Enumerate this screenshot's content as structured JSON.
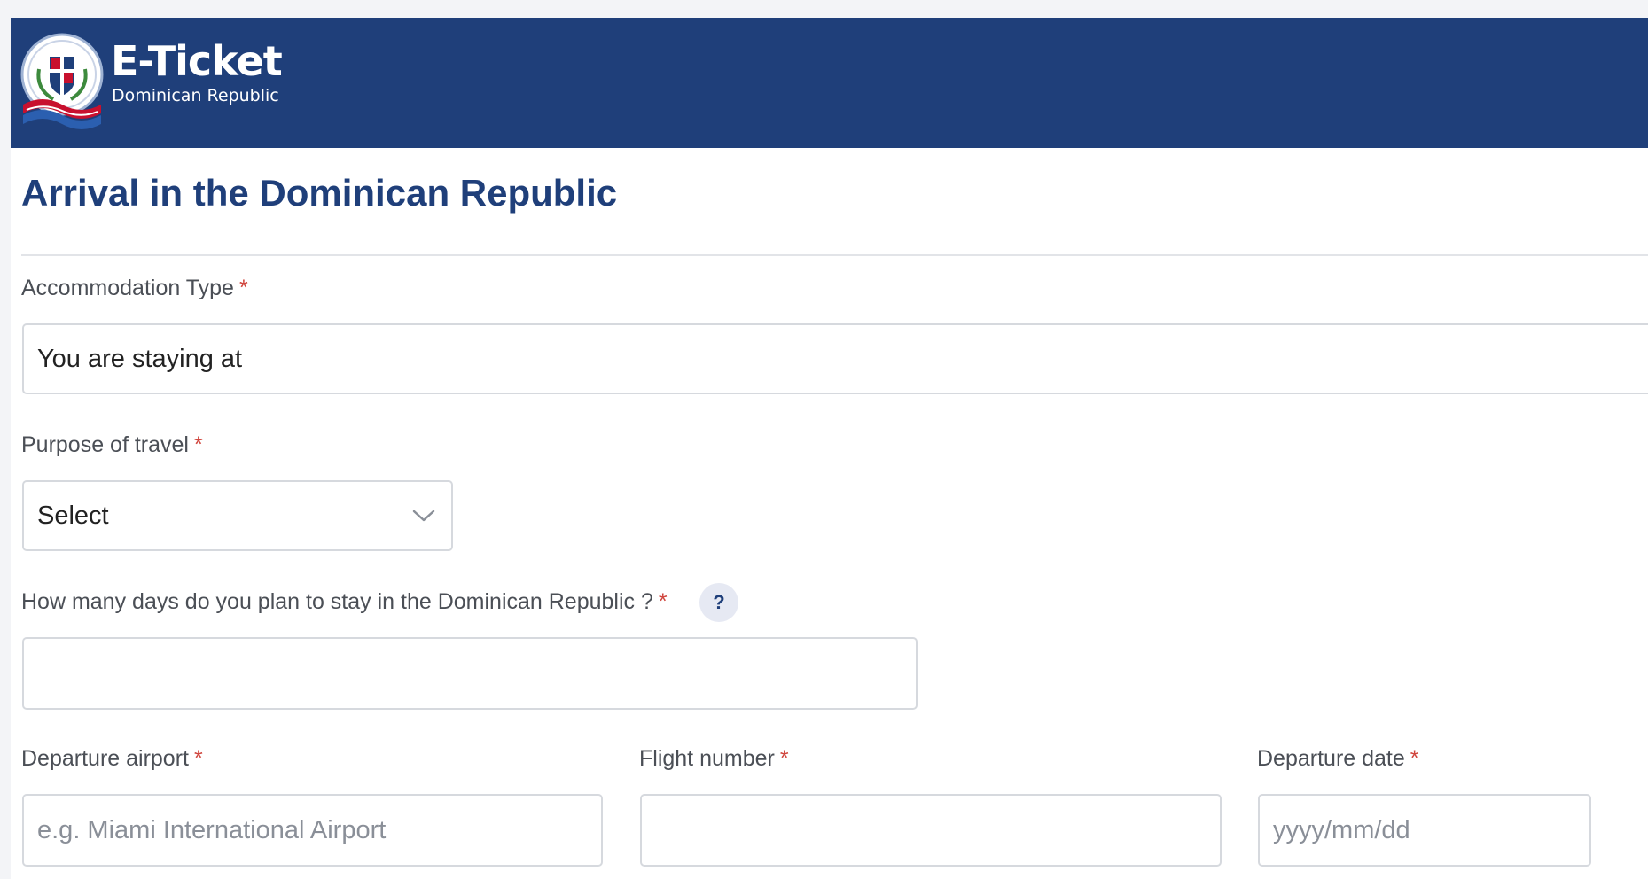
{
  "header": {
    "title": "E-Ticket",
    "subtitle": "Dominican Republic",
    "logo_icon": "dominican-coat-of-arms-logo",
    "background_color": "#1f3f7a"
  },
  "page": {
    "title": "Arrival in the Dominican Republic",
    "required_marker": "*"
  },
  "form": {
    "accommodation_type": {
      "label": "Accommodation Type",
      "value": "You are staying at"
    },
    "purpose_of_travel": {
      "label": "Purpose of travel",
      "value": "Select"
    },
    "days_of_stay": {
      "label": "How many days do you plan to stay in the Dominican Republic ?",
      "help": "?",
      "value": ""
    },
    "departure_airport": {
      "label": "Departure airport",
      "placeholder": "e.g. Miami International Airport",
      "value": ""
    },
    "flight_number": {
      "label": "Flight number",
      "value": ""
    },
    "departure_date": {
      "label": "Departure date",
      "placeholder": "yyyy/mm/dd",
      "value": ""
    }
  }
}
